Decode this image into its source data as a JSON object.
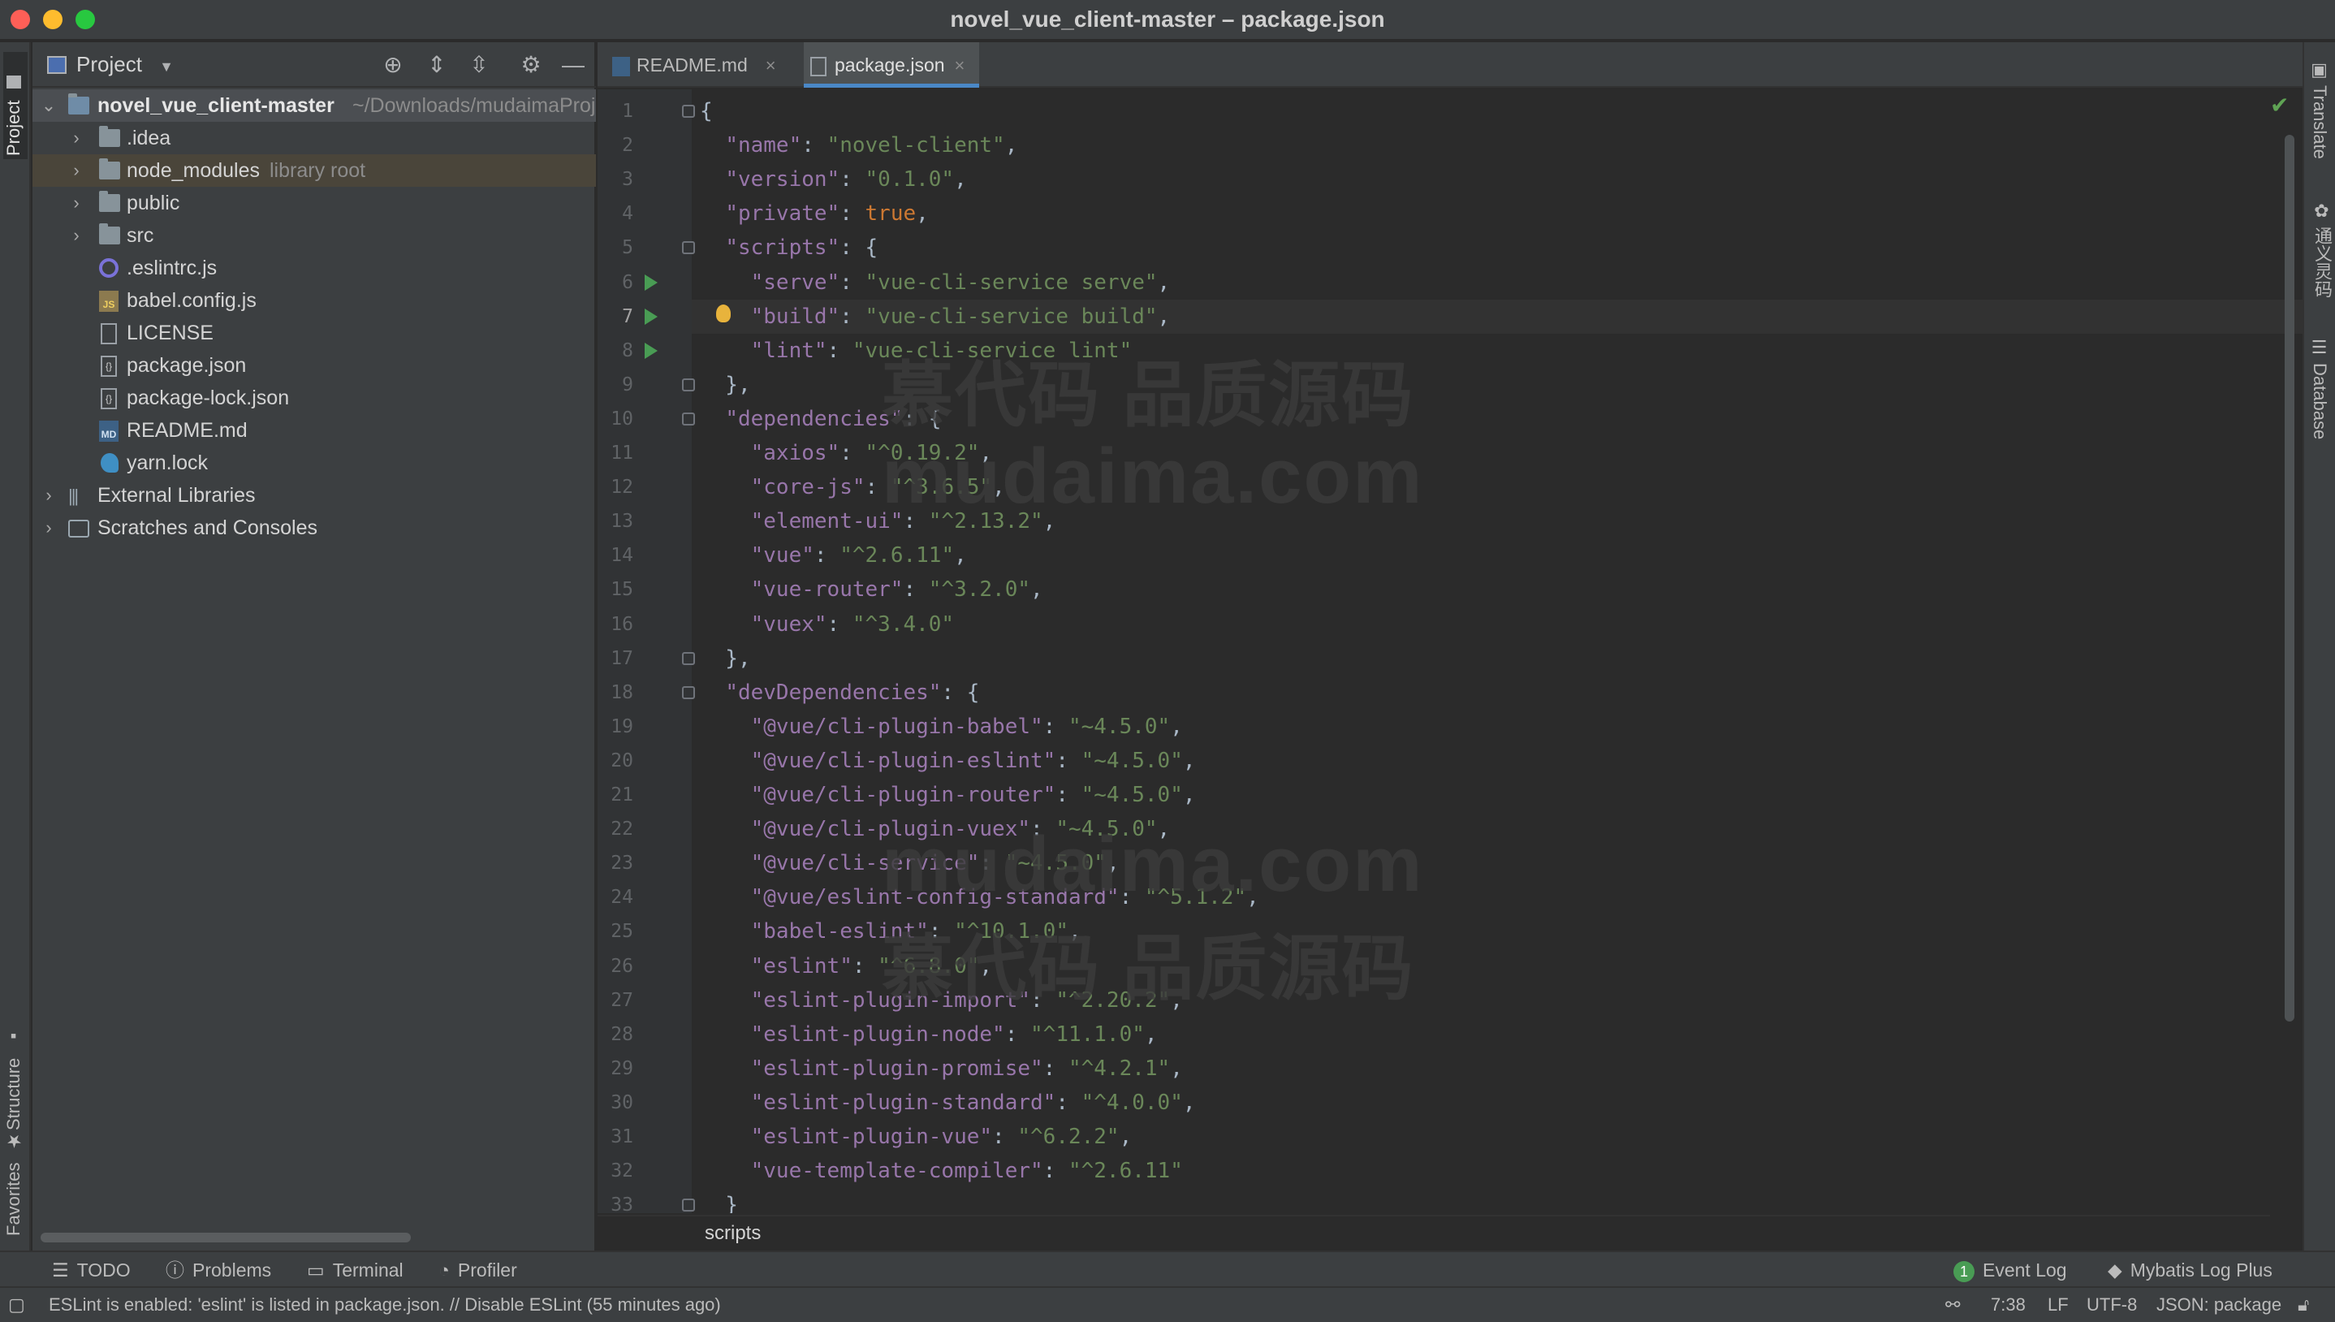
{
  "window": {
    "title": "novel_vue_client-master – package.json"
  },
  "left_stripe": {
    "project": "Project",
    "structure": "Structure",
    "favorites": "Favorites"
  },
  "right_stripe": {
    "translate": "Translate",
    "plugin": "通义灵码",
    "database": "Database"
  },
  "project_panel": {
    "title": "Project",
    "root": {
      "name": "novel_vue_client-master",
      "path": "~/Downloads/mudaimaProj"
    },
    "items": [
      {
        "name": ".idea",
        "icon": "folder-icon"
      },
      {
        "name": "node_modules",
        "suffix": "library root",
        "icon": "folder-icon"
      },
      {
        "name": "public",
        "icon": "folder-icon"
      },
      {
        "name": "src",
        "icon": "folder-icon"
      },
      {
        "name": ".eslintrc.js",
        "icon": "eslint-file-icon"
      },
      {
        "name": "babel.config.js",
        "icon": "js-file-icon"
      },
      {
        "name": "LICENSE",
        "icon": "text-file-icon"
      },
      {
        "name": "package.json",
        "icon": "json-file-icon"
      },
      {
        "name": "package-lock.json",
        "icon": "json-file-icon"
      },
      {
        "name": "README.md",
        "icon": "markdown-file-icon"
      },
      {
        "name": "yarn.lock",
        "icon": "yarn-file-icon"
      }
    ],
    "external_libraries": "External Libraries",
    "scratches": "Scratches and Consoles"
  },
  "tabs": [
    {
      "label": "README.md",
      "active": false
    },
    {
      "label": "package.json",
      "active": true
    }
  ],
  "code": {
    "current_line": 7,
    "lines": [
      [
        [
          "p",
          "{"
        ]
      ],
      [
        [
          "p",
          "  "
        ],
        [
          "k",
          "\"name\""
        ],
        [
          "p",
          ": "
        ],
        [
          "s",
          "\"novel-client\""
        ],
        [
          "p",
          ","
        ]
      ],
      [
        [
          "p",
          "  "
        ],
        [
          "k",
          "\"version\""
        ],
        [
          "p",
          ": "
        ],
        [
          "s",
          "\"0.1.0\""
        ],
        [
          "p",
          ","
        ]
      ],
      [
        [
          "p",
          "  "
        ],
        [
          "k",
          "\"private\""
        ],
        [
          "p",
          ": "
        ],
        [
          "w",
          "true"
        ],
        [
          "p",
          ","
        ]
      ],
      [
        [
          "p",
          "  "
        ],
        [
          "k",
          "\"scripts\""
        ],
        [
          "p",
          ": {"
        ]
      ],
      [
        [
          "p",
          "    "
        ],
        [
          "k",
          "\"serve\""
        ],
        [
          "p",
          ": "
        ],
        [
          "s",
          "\"vue-cli-service serve\""
        ],
        [
          "p",
          ","
        ]
      ],
      [
        [
          "p",
          "    "
        ],
        [
          "k",
          "\"build\""
        ],
        [
          "p",
          ": "
        ],
        [
          "s",
          "\"vue-cli-service build\""
        ],
        [
          "p",
          ","
        ]
      ],
      [
        [
          "p",
          "    "
        ],
        [
          "k",
          "\"lint\""
        ],
        [
          "p",
          ": "
        ],
        [
          "s",
          "\"vue-cli-service lint\""
        ]
      ],
      [
        [
          "p",
          "  },"
        ]
      ],
      [
        [
          "p",
          "  "
        ],
        [
          "k",
          "\"dependencies\""
        ],
        [
          "p",
          ": {"
        ]
      ],
      [
        [
          "p",
          "    "
        ],
        [
          "k",
          "\"axios\""
        ],
        [
          "p",
          ": "
        ],
        [
          "s",
          "\"^0.19.2\""
        ],
        [
          "p",
          ","
        ]
      ],
      [
        [
          "p",
          "    "
        ],
        [
          "k",
          "\"core-js\""
        ],
        [
          "p",
          ": "
        ],
        [
          "s",
          "\"^3.6.5\""
        ],
        [
          "p",
          ","
        ]
      ],
      [
        [
          "p",
          "    "
        ],
        [
          "k",
          "\"element-ui\""
        ],
        [
          "p",
          ": "
        ],
        [
          "s",
          "\"^2.13.2\""
        ],
        [
          "p",
          ","
        ]
      ],
      [
        [
          "p",
          "    "
        ],
        [
          "k",
          "\"vue\""
        ],
        [
          "p",
          ": "
        ],
        [
          "s",
          "\"^2.6.11\""
        ],
        [
          "p",
          ","
        ]
      ],
      [
        [
          "p",
          "    "
        ],
        [
          "k",
          "\"vue-router\""
        ],
        [
          "p",
          ": "
        ],
        [
          "s",
          "\"^3.2.0\""
        ],
        [
          "p",
          ","
        ]
      ],
      [
        [
          "p",
          "    "
        ],
        [
          "k",
          "\"vuex\""
        ],
        [
          "p",
          ": "
        ],
        [
          "s",
          "\"^3.4.0\""
        ]
      ],
      [
        [
          "p",
          "  },"
        ]
      ],
      [
        [
          "p",
          "  "
        ],
        [
          "k",
          "\"devDependencies\""
        ],
        [
          "p",
          ": {"
        ]
      ],
      [
        [
          "p",
          "    "
        ],
        [
          "k",
          "\"@vue/cli-plugin-babel\""
        ],
        [
          "p",
          ": "
        ],
        [
          "s",
          "\"~4.5.0\""
        ],
        [
          "p",
          ","
        ]
      ],
      [
        [
          "p",
          "    "
        ],
        [
          "k",
          "\"@vue/cli-plugin-eslint\""
        ],
        [
          "p",
          ": "
        ],
        [
          "s",
          "\"~4.5.0\""
        ],
        [
          "p",
          ","
        ]
      ],
      [
        [
          "p",
          "    "
        ],
        [
          "k",
          "\"@vue/cli-plugin-router\""
        ],
        [
          "p",
          ": "
        ],
        [
          "s",
          "\"~4.5.0\""
        ],
        [
          "p",
          ","
        ]
      ],
      [
        [
          "p",
          "    "
        ],
        [
          "k",
          "\"@vue/cli-plugin-vuex\""
        ],
        [
          "p",
          ": "
        ],
        [
          "s",
          "\"~4.5.0\""
        ],
        [
          "p",
          ","
        ]
      ],
      [
        [
          "p",
          "    "
        ],
        [
          "k",
          "\"@vue/cli-service\""
        ],
        [
          "p",
          ": "
        ],
        [
          "s",
          "\"~4.5.0\""
        ],
        [
          "p",
          ","
        ]
      ],
      [
        [
          "p",
          "    "
        ],
        [
          "k",
          "\"@vue/eslint-config-standard\""
        ],
        [
          "p",
          ": "
        ],
        [
          "s",
          "\"^5.1.2\""
        ],
        [
          "p",
          ","
        ]
      ],
      [
        [
          "p",
          "    "
        ],
        [
          "k",
          "\"babel-eslint\""
        ],
        [
          "p",
          ": "
        ],
        [
          "s",
          "\"^10.1.0\""
        ],
        [
          "p",
          ","
        ]
      ],
      [
        [
          "p",
          "    "
        ],
        [
          "k",
          "\"eslint\""
        ],
        [
          "p",
          ": "
        ],
        [
          "s",
          "\"^6.8.0\""
        ],
        [
          "p",
          ","
        ]
      ],
      [
        [
          "p",
          "    "
        ],
        [
          "k",
          "\"eslint-plugin-import\""
        ],
        [
          "p",
          ": "
        ],
        [
          "s",
          "\"^2.20.2\""
        ],
        [
          "p",
          ","
        ]
      ],
      [
        [
          "p",
          "    "
        ],
        [
          "k",
          "\"eslint-plugin-node\""
        ],
        [
          "p",
          ": "
        ],
        [
          "s",
          "\"^11.1.0\""
        ],
        [
          "p",
          ","
        ]
      ],
      [
        [
          "p",
          "    "
        ],
        [
          "k",
          "\"eslint-plugin-promise\""
        ],
        [
          "p",
          ": "
        ],
        [
          "s",
          "\"^4.2.1\""
        ],
        [
          "p",
          ","
        ]
      ],
      [
        [
          "p",
          "    "
        ],
        [
          "k",
          "\"eslint-plugin-standard\""
        ],
        [
          "p",
          ": "
        ],
        [
          "s",
          "\"^4.0.0\""
        ],
        [
          "p",
          ","
        ]
      ],
      [
        [
          "p",
          "    "
        ],
        [
          "k",
          "\"eslint-plugin-vue\""
        ],
        [
          "p",
          ": "
        ],
        [
          "s",
          "\"^6.2.2\""
        ],
        [
          "p",
          ","
        ]
      ],
      [
        [
          "p",
          "    "
        ],
        [
          "k",
          "\"vue-template-compiler\""
        ],
        [
          "p",
          ": "
        ],
        [
          "s",
          "\"^2.6.11\""
        ]
      ],
      [
        [
          "p",
          "  }"
        ]
      ]
    ],
    "run_lines": [
      6,
      7,
      8
    ],
    "fold_lines": [
      1,
      5,
      9,
      10,
      17,
      18,
      33
    ]
  },
  "breadcrumb": "scripts",
  "watermarks": {
    "cn": "慕代码 品质源码",
    "en": "mudaima.com"
  },
  "tool_windows": {
    "todo": "TODO",
    "problems": "Problems",
    "terminal": "Terminal",
    "profiler": "Profiler",
    "event_log": "Event Log",
    "event_count": "1",
    "mybatis": "Mybatis Log Plus"
  },
  "status": {
    "message": "ESLint is enabled: 'eslint' is listed in package.json. // Disable ESLint (55 minutes ago)",
    "position": "7:38",
    "line_sep": "LF",
    "encoding": "UTF-8",
    "schema": "JSON: package"
  },
  "colors": {
    "accent": "#4a88c7",
    "key": "#9876aa",
    "string": "#6a8759",
    "keyword": "#cc7832",
    "run": "#499c54"
  }
}
